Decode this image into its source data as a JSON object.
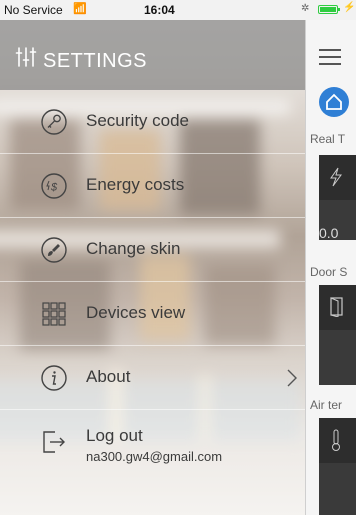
{
  "status_bar": {
    "carrier": "No Service",
    "time": "16:04"
  },
  "settings": {
    "title": "SETTINGS",
    "menu": [
      {
        "label": "Security code",
        "icon": "key-icon"
      },
      {
        "label": "Energy costs",
        "icon": "energy-cost-icon"
      },
      {
        "label": "Change skin",
        "icon": "brush-icon"
      },
      {
        "label": "Devices view",
        "icon": "grid-icon"
      },
      {
        "label": "About",
        "icon": "info-icon"
      },
      {
        "label": "Log out",
        "icon": "logout-icon",
        "email": "na300.gw4@gmail.com"
      }
    ]
  },
  "main_peek": {
    "section_realtime": "Real T",
    "energy_value": "0.0",
    "section_door": "Door S",
    "section_air": "Air ter"
  },
  "colors": {
    "header_bg": "#787878",
    "accent_blue": "#2f7fd5",
    "battery_green": "#2ecc40",
    "card_dark": "#2d2d2d"
  }
}
